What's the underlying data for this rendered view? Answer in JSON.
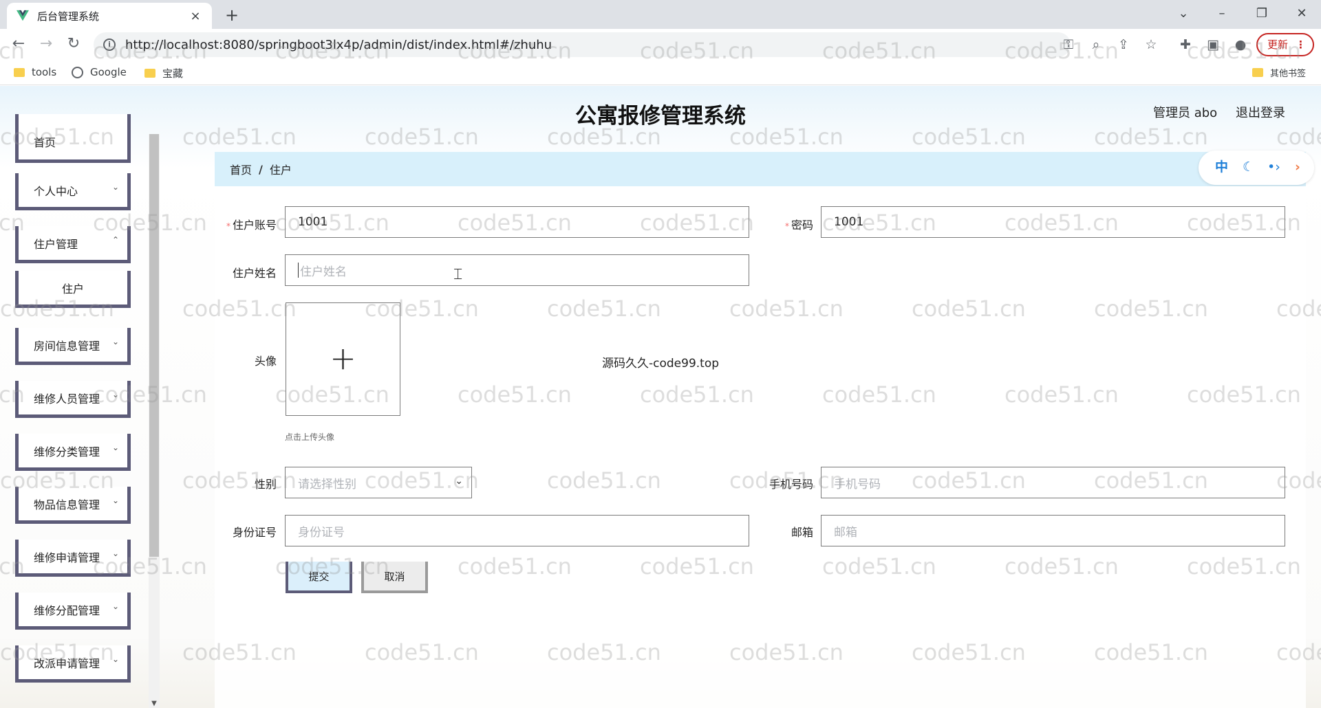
{
  "browser": {
    "tab_title": "后台管理系统",
    "tab_close": "×",
    "new_tab": "+",
    "url": "http://localhost:8080/springboot3lx4p/admin/dist/index.html#/zhuhu",
    "update_label": "更新",
    "bookmarks": [
      "tools",
      "Google",
      "宝藏"
    ],
    "other_bookmarks": "其他书签"
  },
  "header": {
    "title": "公寓报修管理系统",
    "admin_label": "管理员 abo",
    "logout": "退出登录"
  },
  "sidebar": {
    "items": [
      {
        "label": "首页"
      },
      {
        "label": "个人中心"
      },
      {
        "label": "住户管理"
      },
      {
        "label": "住户"
      },
      {
        "label": "房间信息管理"
      },
      {
        "label": "维修人员管理"
      },
      {
        "label": "维修分类管理"
      },
      {
        "label": "物品信息管理"
      },
      {
        "label": "维修申请管理"
      },
      {
        "label": "维修分配管理"
      },
      {
        "label": "改派申请管理"
      }
    ]
  },
  "breadcrumb": {
    "home": "首页",
    "separator": "/",
    "current": "住户"
  },
  "toolbar_pill": {
    "lang": "中"
  },
  "form": {
    "account_label": "住户账号",
    "account_value": "1001",
    "password_label": "密码",
    "password_value": "1001",
    "name_label": "住户姓名",
    "name_placeholder": "住户姓名",
    "avatar_label": "头像",
    "avatar_tip": "点击上传头像",
    "gender_label": "性别",
    "gender_placeholder": "请选择性别",
    "phone_label": "手机号码",
    "phone_placeholder": "手机号码",
    "idcard_label": "身份证号",
    "idcard_placeholder": "身份证号",
    "email_label": "邮箱",
    "email_placeholder": "邮箱",
    "submit": "提交",
    "cancel": "取消",
    "required_mark": "*"
  },
  "promo_text": "源码久久-code99.top",
  "watermark": "code51.cn",
  "colors": {
    "menu_border": "#5c5b78",
    "breadcrumb_bg": "#d8f0fb",
    "submit_bg": "#dbeffb"
  }
}
